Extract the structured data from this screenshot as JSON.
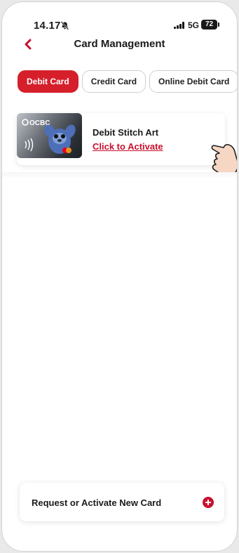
{
  "status_bar": {
    "time": "14.17",
    "network": "5G",
    "battery": "72"
  },
  "header": {
    "title": "Card Management",
    "back_icon": "chevron-left-icon"
  },
  "tabs": [
    {
      "label": "Debit Card",
      "active": true
    },
    {
      "label": "Credit Card",
      "active": false
    },
    {
      "label": "Online Debit Card",
      "active": false
    }
  ],
  "cards": [
    {
      "name": "Debit Stitch Art",
      "action": "Click to Activate",
      "card_brand": "OCBC"
    }
  ],
  "footer": {
    "request_label": "Request or Activate New Card",
    "add_icon": "plus-circle-icon"
  },
  "colors": {
    "accent": "#d5202b",
    "link": "#c8102e"
  }
}
